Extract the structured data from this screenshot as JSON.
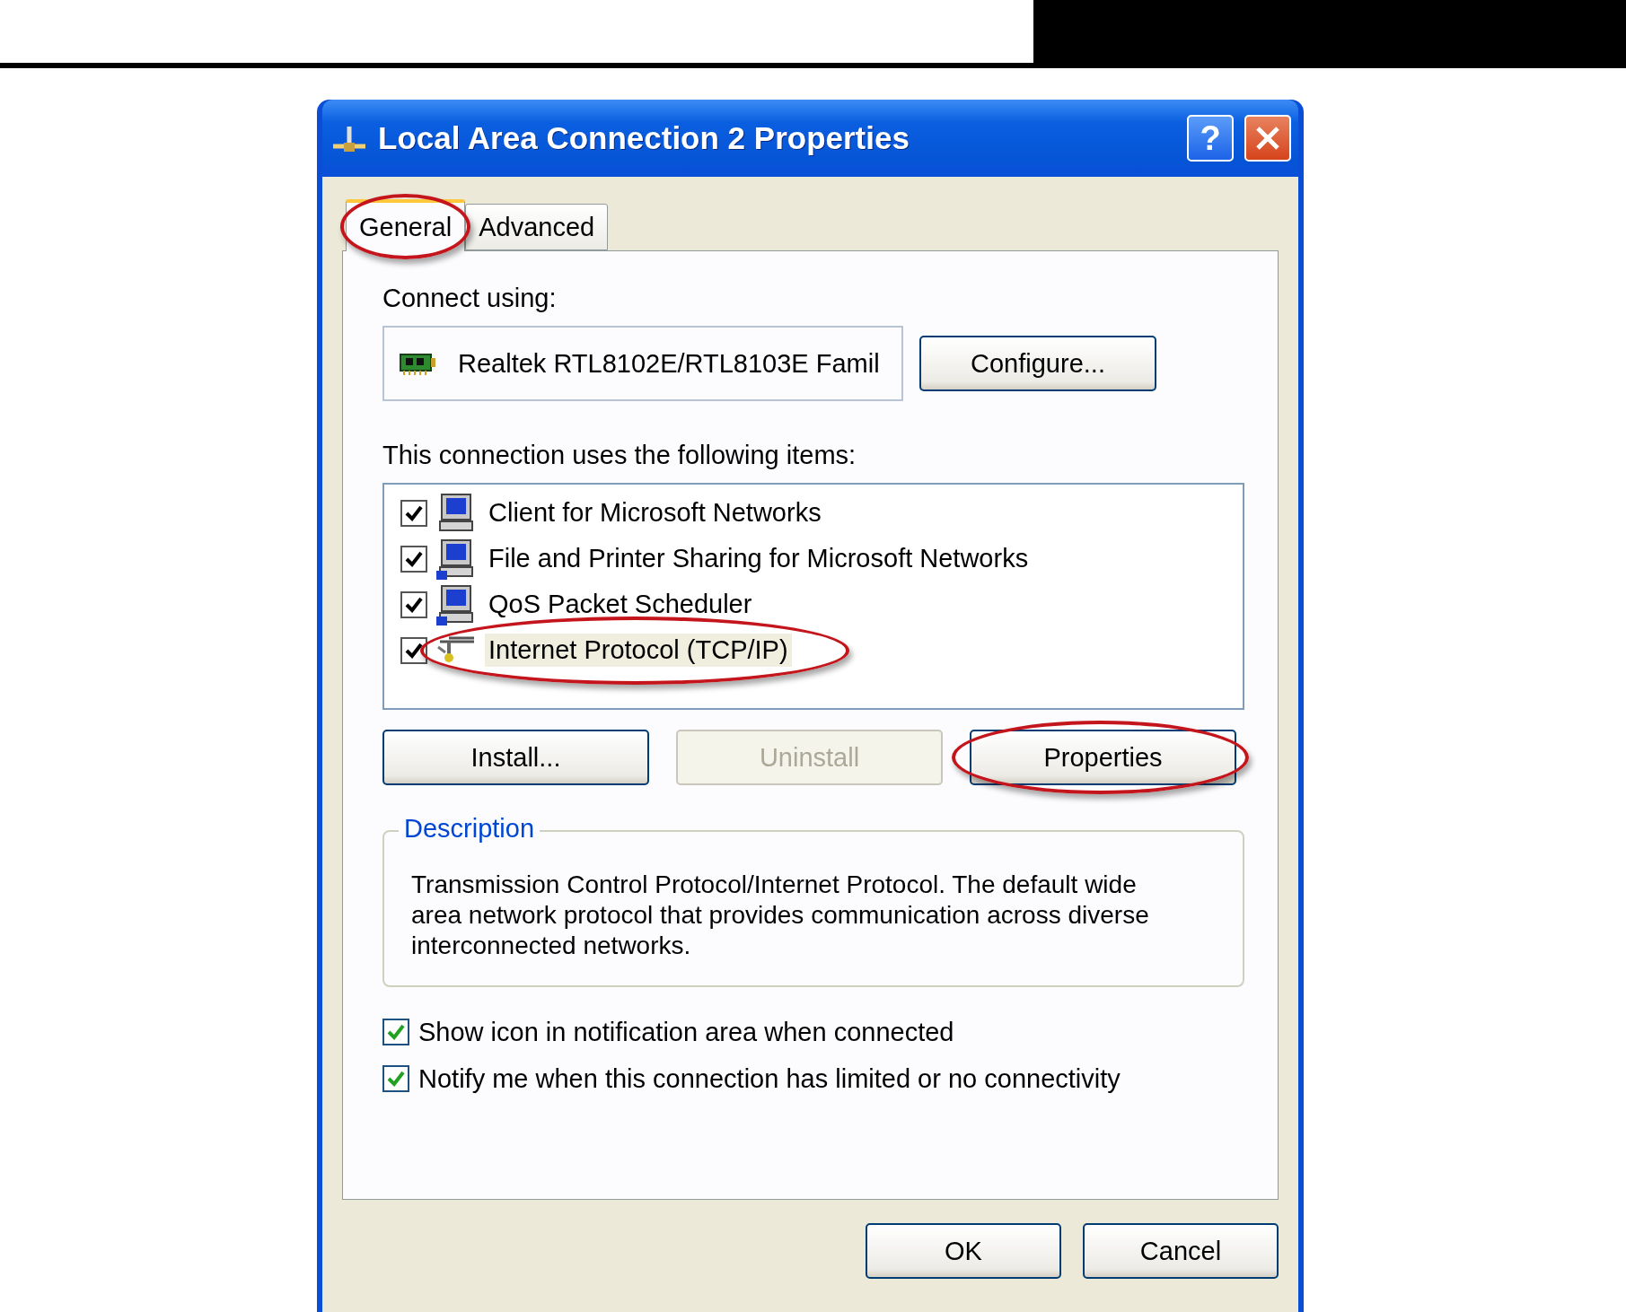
{
  "window": {
    "title": "Local Area Connection 2 Properties",
    "help": "?"
  },
  "tabs": [
    {
      "label": "General",
      "selected": true,
      "circled": true
    },
    {
      "label": "Advanced",
      "selected": false,
      "circled": false
    }
  ],
  "connect_using": {
    "label": "Connect using:",
    "adapter": "Realtek RTL8102E/RTL8103E Famil",
    "button": "Configure..."
  },
  "components": {
    "label": "This connection uses the following items:",
    "items": [
      {
        "kind": "client",
        "label": "Client for Microsoft Networks",
        "checked": true,
        "selected": false,
        "circled": false
      },
      {
        "kind": "service",
        "label": "File and Printer Sharing for Microsoft Networks",
        "checked": true,
        "selected": false,
        "circled": false
      },
      {
        "kind": "service",
        "label": "QoS Packet Scheduler",
        "checked": true,
        "selected": false,
        "circled": false
      },
      {
        "kind": "protocol",
        "label": "Internet Protocol (TCP/IP)",
        "checked": true,
        "selected": true,
        "circled": true
      }
    ]
  },
  "actions": [
    {
      "label": "Install...",
      "disabled": false,
      "circled": false
    },
    {
      "label": "Uninstall",
      "disabled": true,
      "circled": false
    },
    {
      "label": "Properties",
      "disabled": false,
      "circled": true
    }
  ],
  "description": {
    "title": "Description",
    "text": "Transmission Control Protocol/Internet Protocol. The default wide area network protocol that provides communication across diverse interconnected networks."
  },
  "options": [
    {
      "label": "Show icon in notification area when connected",
      "checked": true
    },
    {
      "label": "Notify me when this connection has limited or no connectivity",
      "checked": true
    }
  ],
  "footer_buttons": [
    "OK",
    "Cancel"
  ]
}
